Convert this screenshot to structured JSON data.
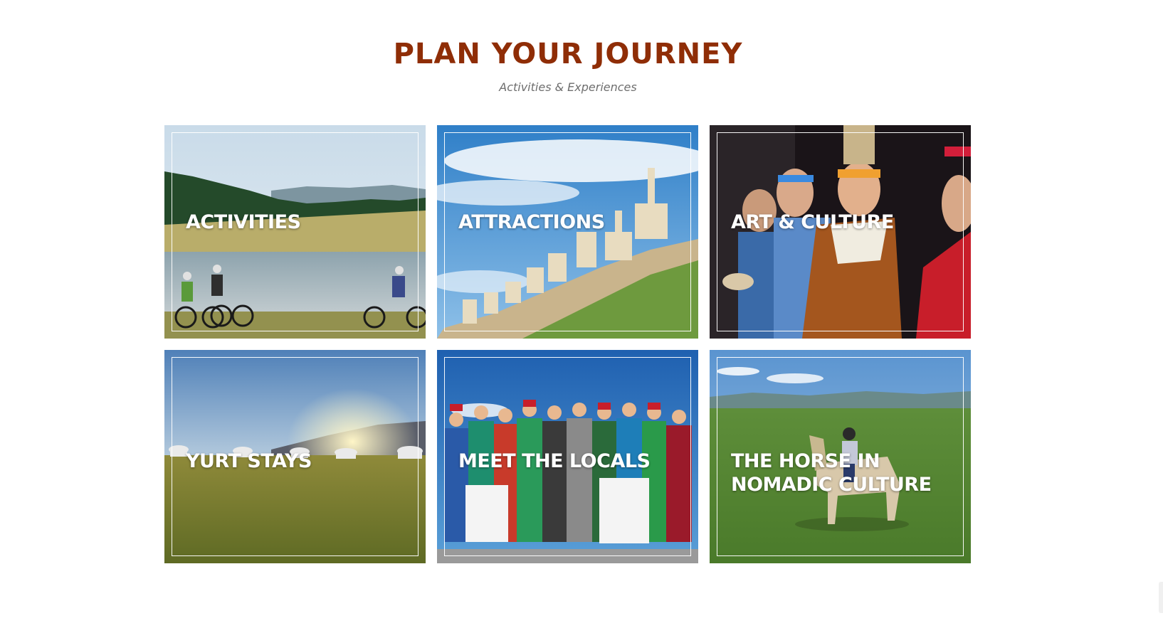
{
  "header": {
    "title": "PLAN YOUR JOURNEY",
    "subtitle": "Activities & Experiences"
  },
  "cards": [
    {
      "label": "ACTIVITIES",
      "image": "cyclists-by-lake-image"
    },
    {
      "label": "ATTRACTIONS",
      "image": "stupa-wall-image"
    },
    {
      "label": "ART & CULTURE",
      "image": "traditional-dancers-image"
    },
    {
      "label": "YURT STAYS",
      "image": "yurt-camp-sunset-image"
    },
    {
      "label": "MEET THE LOCALS",
      "image": "locals-group-photo-image"
    },
    {
      "label": "THE HORSE IN NOMADIC CULTURE",
      "image": "horse-rider-steppe-image"
    }
  ],
  "colors": {
    "title": "#8f2d06",
    "subtitle": "#6e6e6e",
    "card_text": "#ffffff"
  }
}
